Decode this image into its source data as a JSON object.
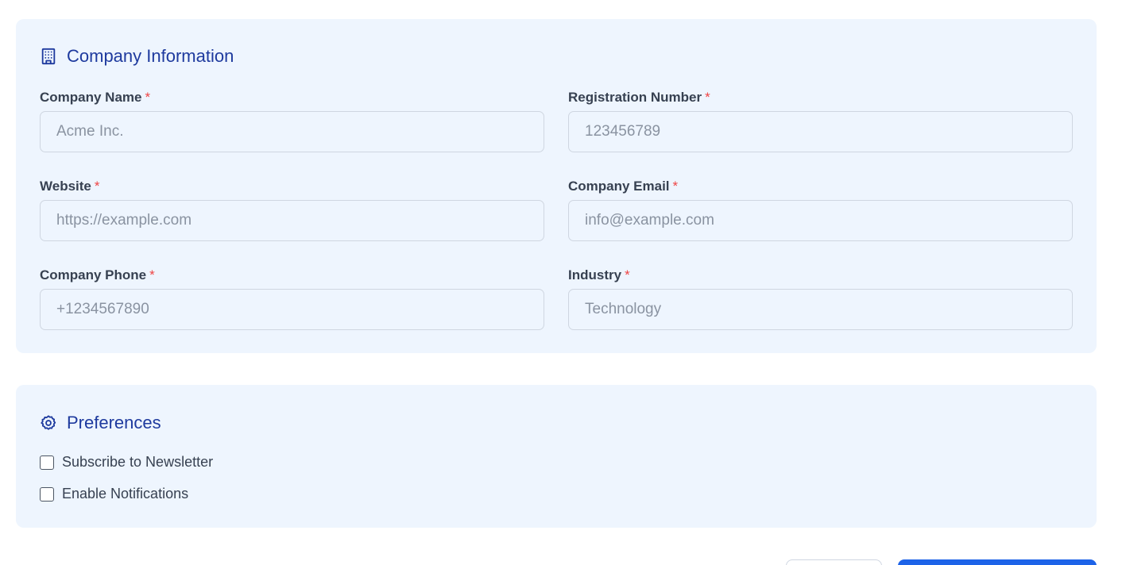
{
  "company_section": {
    "title": "Company Information",
    "icon": "building-icon",
    "accent_color": "#1e3a9e",
    "fields": {
      "company_name": {
        "label": "Company Name",
        "required_mark": "*",
        "placeholder": "Acme Inc.",
        "value": ""
      },
      "registration_number": {
        "label": "Registration Number",
        "required_mark": "*",
        "placeholder": "123456789",
        "value": ""
      },
      "website": {
        "label": "Website",
        "required_mark": "*",
        "placeholder": "https://example.com",
        "value": ""
      },
      "company_email": {
        "label": "Company Email",
        "required_mark": "*",
        "placeholder": "info@example.com",
        "value": ""
      },
      "company_phone": {
        "label": "Company Phone",
        "required_mark": "*",
        "placeholder": "+1234567890",
        "value": ""
      },
      "industry": {
        "label": "Industry",
        "required_mark": "*",
        "placeholder": "Technology",
        "value": ""
      }
    }
  },
  "preferences_section": {
    "title": "Preferences",
    "icon": "gear-icon",
    "options": {
      "newsletter": {
        "label": "Subscribe to Newsletter",
        "checked": false
      },
      "notifications": {
        "label": "Enable Notifications",
        "checked": false
      }
    }
  },
  "actions": {
    "primary_color": "#1d63e8"
  }
}
